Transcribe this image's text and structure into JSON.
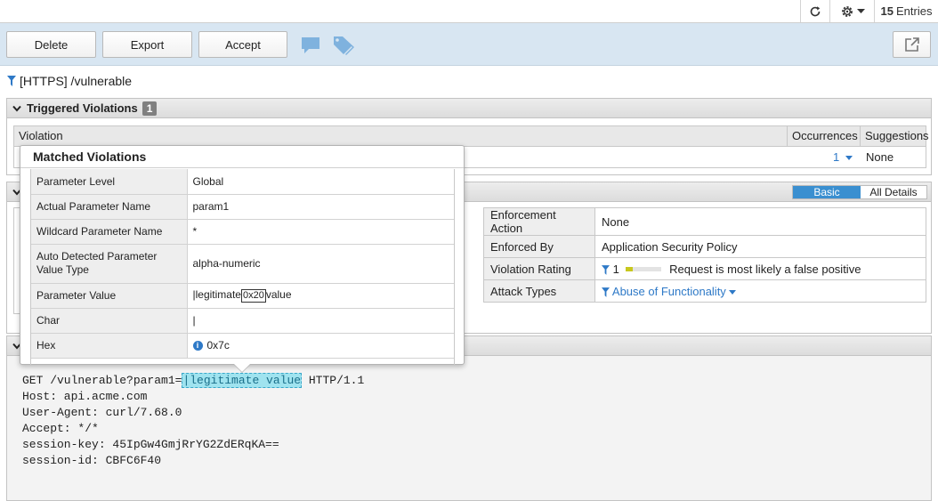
{
  "topbar": {
    "entries_count": "15",
    "entries_label": "Entries",
    "icons": [
      "refresh-icon",
      "gear-icon",
      "caret-down-icon"
    ]
  },
  "toolbar": {
    "delete_label": "Delete",
    "export_label": "Export",
    "accept_label": "Accept",
    "icons": [
      "comment-icon",
      "tag-icon",
      "popout-icon"
    ]
  },
  "filter": {
    "title": "[HTTPS] /vulnerable"
  },
  "triggered": {
    "heading": "Triggered Violations",
    "count": "1",
    "columns": [
      "Violation",
      "Occurrences",
      "Suggestions"
    ],
    "row": {
      "occurrences": "1",
      "suggestions": "None"
    }
  },
  "details": {
    "toggle_basic": "Basic",
    "toggle_all": "All Details",
    "enforcement": [
      {
        "key": "Enforcement Action",
        "value": "None"
      },
      {
        "key": "Enforced By",
        "value": "Application Security Policy"
      },
      {
        "key": "Violation Rating",
        "value": "1",
        "note": "Request is most likely a false positive"
      },
      {
        "key": "Attack Types",
        "value": "Abuse of Functionality"
      }
    ]
  },
  "request": {
    "line1_prefix": "GET /vulnerable?param1=",
    "line1_highlight": "|legitimate value",
    "line1_suffix": " HTTP/1.1",
    "lines": [
      "Host: api.acme.com",
      "User-Agent: curl/7.68.0",
      "Accept: */*",
      "session-key: 45IpGw4GmjRrYG2ZdERqKA==",
      "session-id: CBFC6F40"
    ]
  },
  "popup": {
    "title": "Matched Violations",
    "rows": [
      {
        "key": "Parameter Level",
        "value": "Global"
      },
      {
        "key": "Actual Parameter Name",
        "value": "param1"
      },
      {
        "key": "Wildcard Parameter Name",
        "value": "*"
      },
      {
        "key": "Auto Detected Parameter Value Type",
        "value": "alpha-numeric"
      },
      {
        "key": "Parameter Value",
        "value_pre": "|legitimate",
        "value_hex": "0x20",
        "value_post": "value"
      },
      {
        "key": "Char",
        "value": "|"
      },
      {
        "key": "Hex",
        "value": "0x7c"
      }
    ]
  },
  "colors": {
    "toolbar_bg": "#d8e6f2",
    "accent": "#3a8fd0",
    "link": "#2e79c7",
    "highlight": "#9fe3ef"
  }
}
